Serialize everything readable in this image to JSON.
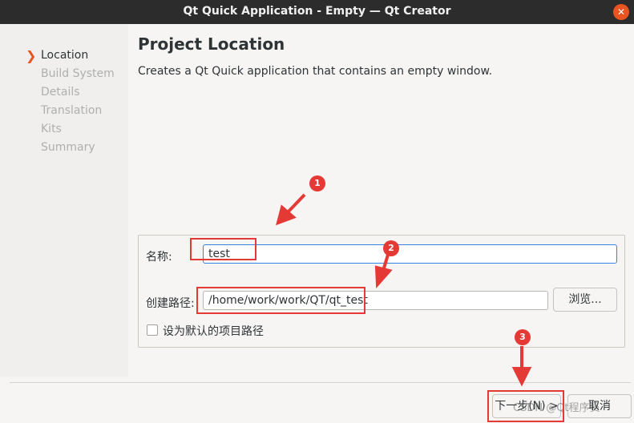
{
  "window": {
    "title": "Qt Quick Application - Empty — Qt Creator",
    "close_glyph": "✕"
  },
  "wizard": {
    "steps": [
      {
        "label": "Location",
        "active": true
      },
      {
        "label": "Build System",
        "active": false
      },
      {
        "label": "Details",
        "active": false
      },
      {
        "label": "Translation",
        "active": false
      },
      {
        "label": "Kits",
        "active": false
      },
      {
        "label": "Summary",
        "active": false
      }
    ],
    "current_marker": "❯"
  },
  "page": {
    "heading": "Project Location",
    "description": "Creates a Qt Quick application that contains an empty window."
  },
  "form": {
    "name_label": "名称:",
    "name_value": "test",
    "path_label": "创建路径:",
    "path_value": "/home/work/work/QT/qt_test",
    "browse_label": "浏览...",
    "default_path_label": "设为默认的项目路径",
    "default_path_checked": false
  },
  "footer": {
    "next_label": "下一步(N) >",
    "cancel_label": "取消"
  },
  "annotations": {
    "markers": [
      "1",
      "2",
      "3"
    ],
    "color": "#e53935"
  },
  "watermark": "CSDN @Qt程序员"
}
